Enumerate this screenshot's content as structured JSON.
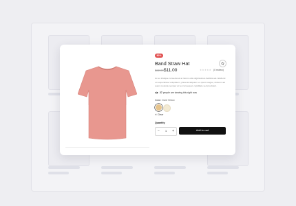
{
  "product": {
    "badge": "50%",
    "title": "Band Straw Hat",
    "old_price": "$22.00",
    "price": "$11.00",
    "stars": "★★★★★",
    "reviews_label": "(0 review)",
    "description": "Ac eu tristique consectetur at rutrum odio dignissimos facilisis aut. Eleifend ut suspendisse voluptatem, placerat aliquam a a ipsum augue, dolorem ad quam molestie semper at vel consequat. cupiditate sed provident.",
    "viewing_count": "27",
    "viewing_text": "people are viewing this right now",
    "color_label": "Color:",
    "color_value": "Dark Yellow",
    "swatch_colors": [
      "#e6c48d",
      "#f3ead3"
    ],
    "clear_label": "Clear",
    "quantity_label": "Quantity",
    "quantity_value": "1",
    "minus": "−",
    "plus": "+",
    "add_to_cart": "Add to cart",
    "shirt_color": "#e8978f",
    "accent_badge": "#e04a4a"
  }
}
